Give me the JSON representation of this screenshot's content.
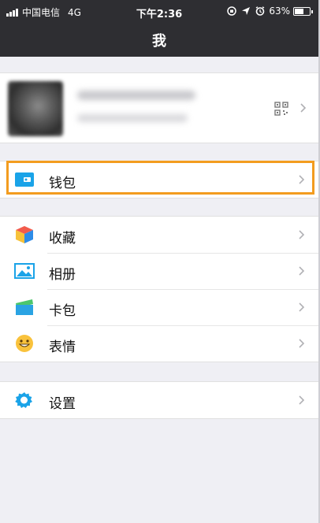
{
  "status_bar": {
    "carrier": "中国电信",
    "network": "4G",
    "time": "下午2:36",
    "battery": "63%",
    "icons": [
      "signal-icon",
      "rotation-lock-icon",
      "location-icon",
      "alarm-icon",
      "battery-icon"
    ]
  },
  "nav": {
    "title": "我"
  },
  "profile": {
    "icons": [
      "avatar",
      "qr-code-icon",
      "chevron-right-icon"
    ]
  },
  "menu": {
    "wallet": {
      "label": "钱包",
      "icon": "wallet-icon"
    },
    "group2": [
      {
        "label": "收藏",
        "icon": "favorites-cube-icon"
      },
      {
        "label": "相册",
        "icon": "album-icon"
      },
      {
        "label": "卡包",
        "icon": "card-wallet-icon"
      },
      {
        "label": "表情",
        "icon": "emoji-icon"
      }
    ],
    "settings": {
      "label": "设置",
      "icon": "gear-icon"
    }
  },
  "colors": {
    "nav_bg": "#2e2e32",
    "page_bg": "#efeff4",
    "highlight": "#f39c1f",
    "accent_blue": "#1aa3e8"
  }
}
